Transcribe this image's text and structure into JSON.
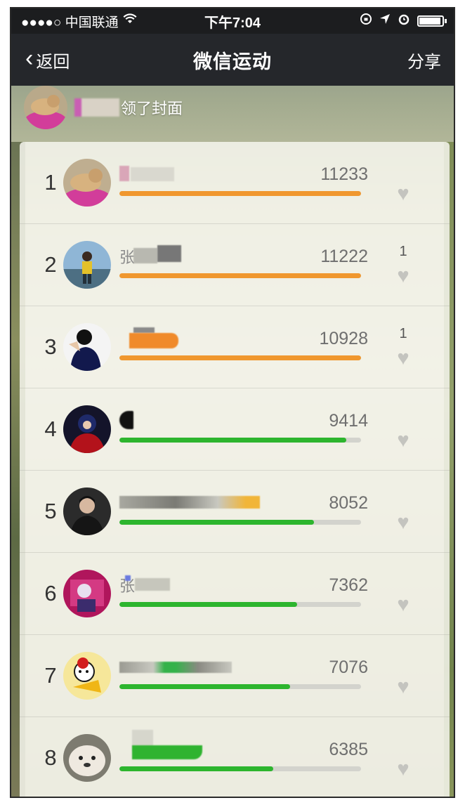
{
  "status_bar": {
    "carrier": "●●●●○ 中国联通",
    "time": "下午7:04"
  },
  "nav": {
    "back_label": "返回",
    "title": "微信运动",
    "share_label": "分享"
  },
  "cover_banner": {
    "text": "领了封面"
  },
  "colors": {
    "orange": "#f0972e",
    "green": "#2db52e",
    "track": "#d3d3cd"
  },
  "ranking": [
    {
      "rank": "1",
      "name": "",
      "steps": "11233",
      "progress": 1.0,
      "bar_color": "#f0972e",
      "likes": ""
    },
    {
      "rank": "2",
      "name": "张",
      "steps": "11222",
      "progress": 1.0,
      "bar_color": "#f0972e",
      "likes": "1"
    },
    {
      "rank": "3",
      "name": "",
      "steps": "10928",
      "progress": 1.0,
      "bar_color": "#f0972e",
      "likes": "1"
    },
    {
      "rank": "4",
      "name": "",
      "steps": "9414",
      "progress": 0.94,
      "bar_color": "#2db52e",
      "likes": ""
    },
    {
      "rank": "5",
      "name": "",
      "steps": "8052",
      "progress": 0.805,
      "bar_color": "#2db52e",
      "likes": ""
    },
    {
      "rank": "6",
      "name": "张",
      "steps": "7362",
      "progress": 0.736,
      "bar_color": "#2db52e",
      "likes": ""
    },
    {
      "rank": "7",
      "name": "",
      "steps": "7076",
      "progress": 0.707,
      "bar_color": "#2db52e",
      "likes": ""
    },
    {
      "rank": "8",
      "name": "",
      "steps": "6385",
      "progress": 0.638,
      "bar_color": "#2db52e",
      "likes": ""
    }
  ]
}
